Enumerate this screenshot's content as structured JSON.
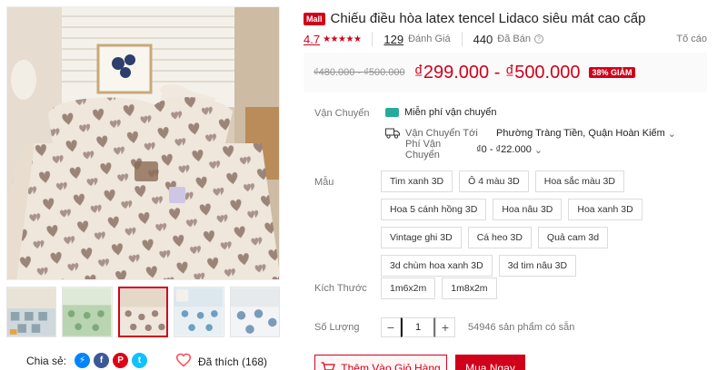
{
  "gallery": {
    "thumb_count": 5
  },
  "share": {
    "label": "Chia sẻ:",
    "icons": [
      "messenger-icon",
      "facebook-icon",
      "pinterest-icon",
      "twitter-icon"
    ]
  },
  "likes": {
    "label": "Đã thích (168)"
  },
  "product": {
    "mall_badge": "Mall",
    "title": "Chiếu điều hòa latex tencel Lidaco siêu mát cao cấp",
    "rating": "4.7",
    "stars": "★★★★★",
    "reviews_count": "129",
    "reviews_label": "Đánh Giá",
    "sold_count": "440",
    "sold_label": "Đã Bán",
    "report_label": "Tố cáo",
    "old_price": "₫480.000 - ₫500.000",
    "price": "₫299.000 - ₫500.000",
    "discount": "38% GIẢM"
  },
  "shipping": {
    "label": "Vận Chuyển",
    "free": "Miễn phí vận chuyển",
    "to_label": "Vận Chuyển Tới",
    "to_value": "Phường Tràng Tiền, Quận Hoàn Kiếm",
    "fee_label": "Phí Vận Chuyển",
    "fee_value": "₫0 - ₫22.000"
  },
  "variants": {
    "label": "Mẫu",
    "options": [
      "Tim xanh 3D",
      "Ô 4 màu 3D",
      "Hoa sắc màu 3D",
      "Hoa 5 cánh hồng 3D",
      "Hoa nâu 3D",
      "Hoa xanh 3D",
      "Vintage ghi 3D",
      "Cá heo 3D",
      "Quả cam 3d",
      "3d chùm hoa xanh 3D",
      "3d tim nâu 3D"
    ]
  },
  "sizes": {
    "label": "Kích Thước",
    "options": [
      "1m6x2m",
      "1m8x2m"
    ]
  },
  "quantity": {
    "label": "Số Lượng",
    "value": "1",
    "minus": "−",
    "plus": "+",
    "stock": "54946 sản phẩm có sẵn"
  },
  "actions": {
    "add_to_cart": "Thêm Vào Giỏ Hàng",
    "buy_now": "Mua Ngay"
  },
  "colors": {
    "brand": "#d0011b",
    "free_ship": "#26aa99"
  }
}
